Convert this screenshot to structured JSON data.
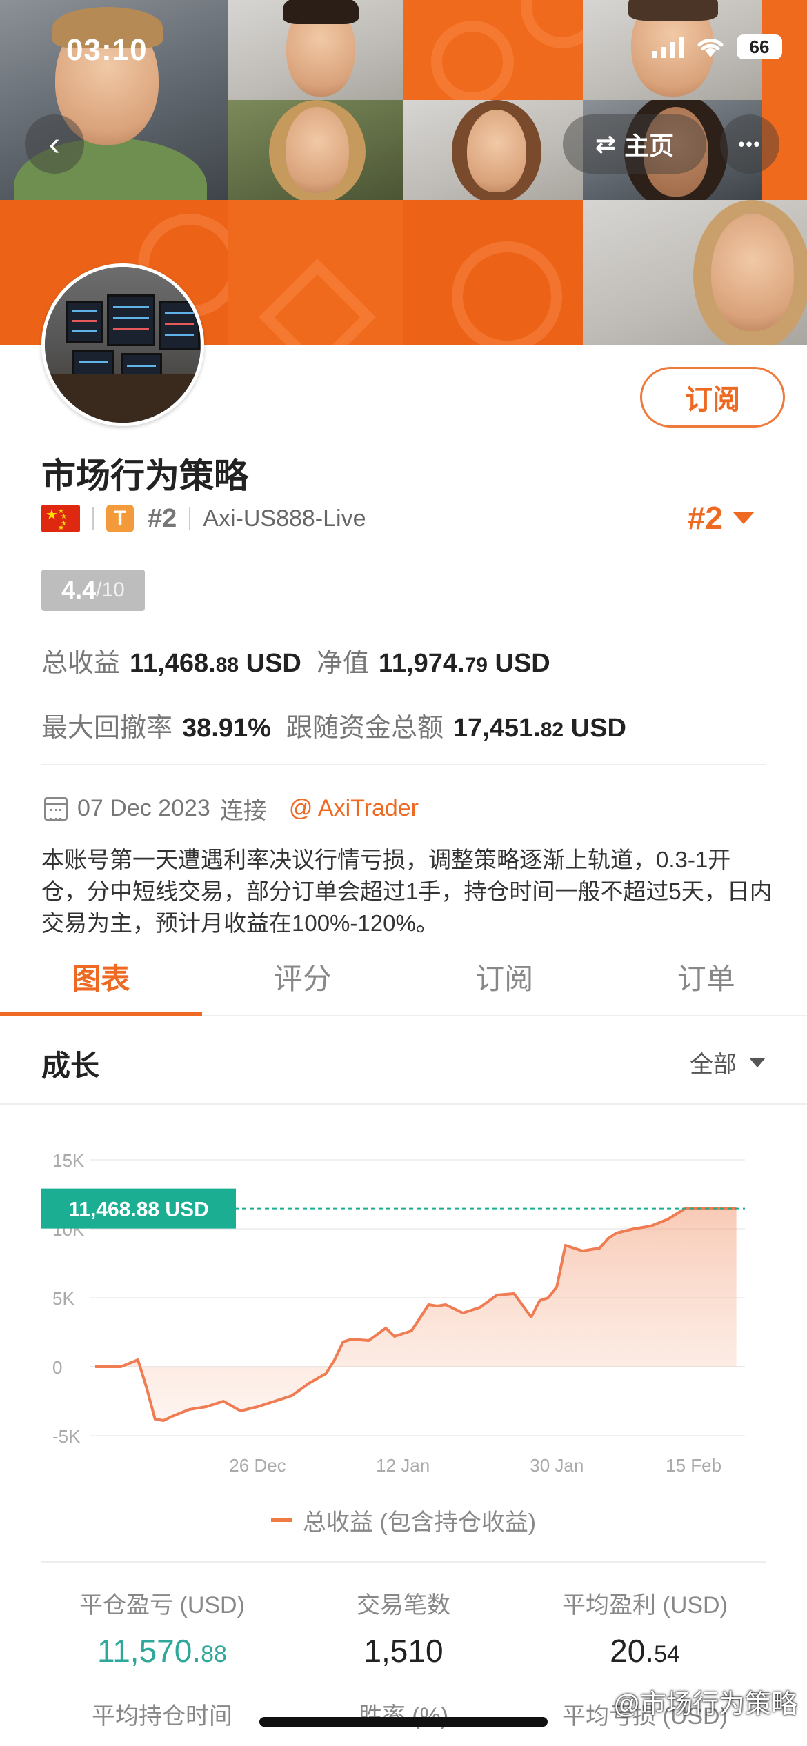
{
  "status_bar": {
    "time": "03:10",
    "battery": "66"
  },
  "nav": {
    "back_icon": "‹",
    "home_label": "主页",
    "home_icon": "⇄",
    "more_icon": "•••"
  },
  "header": {
    "subscribe_label": "订阅",
    "title": "市场行为策略",
    "badge_letter": "T",
    "rank_small": "#2",
    "account": "Axi-US888-Live",
    "rank_big": "#2",
    "score_value": "4.4",
    "score_suffix": "/10"
  },
  "stats": {
    "total_profit_label": "总收益",
    "total_profit_main": "11,468.",
    "total_profit_dec": "88",
    "equity_label": "净值",
    "equity_main": "11,974.",
    "equity_dec": "79",
    "currency": "USD",
    "max_drawdown_label": "最大回撤率",
    "max_drawdown_value": "38.91%",
    "follow_funds_label": "跟随资金总额",
    "follow_funds_main": "17,451.",
    "follow_funds_dec": "82"
  },
  "connect": {
    "date": "07 Dec 2023",
    "label": "连接",
    "trader": "@ AxiTrader"
  },
  "description": "本账号第一天遭遇利率决议行情亏损，调整策略逐渐上轨道，0.3-1开仓，分中短线交易，部分订单会超过1手，持仓时间一般不超过5天，日内交易为主，预计月收益在100%-120%。",
  "tabs": [
    {
      "label": "图表",
      "active": true
    },
    {
      "label": "评分",
      "active": false
    },
    {
      "label": "订阅",
      "active": false
    },
    {
      "label": "订单",
      "active": false
    }
  ],
  "section": {
    "title": "成长",
    "range": "全部"
  },
  "colors": {
    "accent": "#ee6a22",
    "teal": "#1bae92",
    "positive": "#2fa89b",
    "area_stroke": "#ef7c52"
  },
  "chart_data": {
    "type": "area",
    "ylim": [
      -5000,
      15000
    ],
    "yticks": [
      15000,
      10000,
      5000,
      0,
      -5000
    ],
    "ytick_labels": [
      "15K",
      "10K",
      "5K",
      "0",
      "-5K"
    ],
    "xticks": [
      "26 Dec",
      "12 Jan",
      "30 Jan",
      "15 Feb"
    ],
    "xlim": [
      "2023-12-07",
      "2024-02-21"
    ],
    "current_label": "11,468.88 USD",
    "current_value": 11468.88,
    "series": [
      {
        "name": "总收益 (包含持仓收益)",
        "x": [
          "2023-12-07",
          "2023-12-10",
          "2023-12-12",
          "2023-12-13",
          "2023-12-14",
          "2023-12-15",
          "2023-12-16",
          "2023-12-18",
          "2023-12-20",
          "2023-12-22",
          "2023-12-24",
          "2023-12-26",
          "2023-12-28",
          "2023-12-30",
          "2024-01-01",
          "2024-01-03",
          "2024-01-04",
          "2024-01-05",
          "2024-01-06",
          "2024-01-08",
          "2024-01-10",
          "2024-01-11",
          "2024-01-12",
          "2024-01-13",
          "2024-01-15",
          "2024-01-16",
          "2024-01-17",
          "2024-01-19",
          "2024-01-21",
          "2024-01-23",
          "2024-01-25",
          "2024-01-27",
          "2024-01-28",
          "2024-01-29",
          "2024-01-30",
          "2024-01-31",
          "2024-02-02",
          "2024-02-04",
          "2024-02-05",
          "2024-02-06",
          "2024-02-08",
          "2024-02-10",
          "2024-02-12",
          "2024-02-14",
          "2024-02-16",
          "2024-02-18",
          "2024-02-20"
        ],
        "values": [
          0,
          0,
          500,
          -1500,
          -3800,
          -3900,
          -3600,
          -3100,
          -2900,
          -2500,
          -3200,
          -2900,
          -2500,
          -2100,
          -1200,
          -500,
          500,
          1800,
          2000,
          1900,
          2800,
          2200,
          2400,
          2600,
          4500,
          4400,
          4500,
          3900,
          4300,
          5200,
          5300,
          3600,
          4800,
          5000,
          5800,
          8800,
          8400,
          8600,
          9300,
          9700,
          10000,
          10200,
          10700,
          11468.88,
          11468.88,
          11468.88,
          11468.88
        ]
      }
    ]
  },
  "summary": [
    {
      "label": "平仓盈亏 (USD)",
      "main": "11,570.",
      "dec": "88",
      "style": "green"
    },
    {
      "label": "交易笔数",
      "main": "1,510",
      "dec": "",
      "style": ""
    },
    {
      "label": "平均盈利 (USD)",
      "main": "20.",
      "dec": "54",
      "style": ""
    },
    {
      "label": "平均持仓时间",
      "main": "",
      "dec": "",
      "style": ""
    },
    {
      "label": "胜率 (%)",
      "main": "",
      "dec": "",
      "style": ""
    },
    {
      "label": "平均亏损 (USD)",
      "main": "",
      "dec": "",
      "style": ""
    }
  ],
  "watermark": "@市场行为策略"
}
